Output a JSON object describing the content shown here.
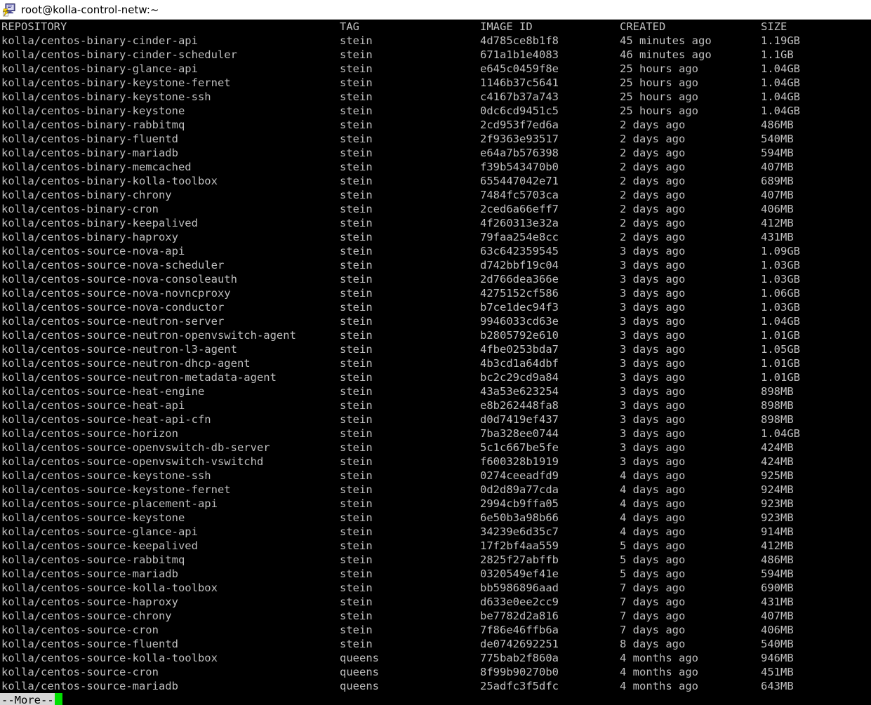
{
  "window": {
    "title": "root@kolla-control-netw:~",
    "icon": "putty-terminal-icon"
  },
  "terminal": {
    "background_color": "#000000",
    "foreground_color": "#bfbfbf",
    "cursor_color": "#00e000",
    "more_prompt": "--More--",
    "more_prompt_bg": "#d6d6d6",
    "more_prompt_fg": "#000000"
  },
  "table": {
    "headers": {
      "repository": "REPOSITORY",
      "tag": "TAG",
      "image_id": "IMAGE ID",
      "created": "CREATED",
      "size": "SIZE"
    },
    "rows": [
      {
        "repository": "kolla/centos-binary-cinder-api",
        "tag": "stein",
        "image_id": "4d785ce8b1f8",
        "created": "45 minutes ago",
        "size": "1.19GB"
      },
      {
        "repository": "kolla/centos-binary-cinder-scheduler",
        "tag": "stein",
        "image_id": "671a1b1e4083",
        "created": "46 minutes ago",
        "size": "1.1GB"
      },
      {
        "repository": "kolla/centos-binary-glance-api",
        "tag": "stein",
        "image_id": "e645c0459f8e",
        "created": "25 hours ago",
        "size": "1.04GB"
      },
      {
        "repository": "kolla/centos-binary-keystone-fernet",
        "tag": "stein",
        "image_id": "1146b37c5641",
        "created": "25 hours ago",
        "size": "1.04GB"
      },
      {
        "repository": "kolla/centos-binary-keystone-ssh",
        "tag": "stein",
        "image_id": "c4167b37a743",
        "created": "25 hours ago",
        "size": "1.04GB"
      },
      {
        "repository": "kolla/centos-binary-keystone",
        "tag": "stein",
        "image_id": "0dc6cd9451c5",
        "created": "25 hours ago",
        "size": "1.04GB"
      },
      {
        "repository": "kolla/centos-binary-rabbitmq",
        "tag": "stein",
        "image_id": "2cd953f7ed6a",
        "created": "2 days ago",
        "size": "486MB"
      },
      {
        "repository": "kolla/centos-binary-fluentd",
        "tag": "stein",
        "image_id": "2f9363e93517",
        "created": "2 days ago",
        "size": "540MB"
      },
      {
        "repository": "kolla/centos-binary-mariadb",
        "tag": "stein",
        "image_id": "e64a7b576398",
        "created": "2 days ago",
        "size": "594MB"
      },
      {
        "repository": "kolla/centos-binary-memcached",
        "tag": "stein",
        "image_id": "f39b543470b0",
        "created": "2 days ago",
        "size": "407MB"
      },
      {
        "repository": "kolla/centos-binary-kolla-toolbox",
        "tag": "stein",
        "image_id": "655447042e71",
        "created": "2 days ago",
        "size": "689MB"
      },
      {
        "repository": "kolla/centos-binary-chrony",
        "tag": "stein",
        "image_id": "7484fc5703ca",
        "created": "2 days ago",
        "size": "407MB"
      },
      {
        "repository": "kolla/centos-binary-cron",
        "tag": "stein",
        "image_id": "2ced6a66eff7",
        "created": "2 days ago",
        "size": "406MB"
      },
      {
        "repository": "kolla/centos-binary-keepalived",
        "tag": "stein",
        "image_id": "4f260313e32a",
        "created": "2 days ago",
        "size": "412MB"
      },
      {
        "repository": "kolla/centos-binary-haproxy",
        "tag": "stein",
        "image_id": "79faa254e8cc",
        "created": "2 days ago",
        "size": "431MB"
      },
      {
        "repository": "kolla/centos-source-nova-api",
        "tag": "stein",
        "image_id": "63c642359545",
        "created": "3 days ago",
        "size": "1.09GB"
      },
      {
        "repository": "kolla/centos-source-nova-scheduler",
        "tag": "stein",
        "image_id": "d742bbf19c04",
        "created": "3 days ago",
        "size": "1.03GB"
      },
      {
        "repository": "kolla/centos-source-nova-consoleauth",
        "tag": "stein",
        "image_id": "2d766dea366e",
        "created": "3 days ago",
        "size": "1.03GB"
      },
      {
        "repository": "kolla/centos-source-nova-novncproxy",
        "tag": "stein",
        "image_id": "4275152cf586",
        "created": "3 days ago",
        "size": "1.06GB"
      },
      {
        "repository": "kolla/centos-source-nova-conductor",
        "tag": "stein",
        "image_id": "b7ce1dec94f3",
        "created": "3 days ago",
        "size": "1.03GB"
      },
      {
        "repository": "kolla/centos-source-neutron-server",
        "tag": "stein",
        "image_id": "9946033cd63e",
        "created": "3 days ago",
        "size": "1.04GB"
      },
      {
        "repository": "kolla/centos-source-neutron-openvswitch-agent",
        "tag": "stein",
        "image_id": "b2805792e610",
        "created": "3 days ago",
        "size": "1.01GB"
      },
      {
        "repository": "kolla/centos-source-neutron-l3-agent",
        "tag": "stein",
        "image_id": "4fbe0253bda7",
        "created": "3 days ago",
        "size": "1.05GB"
      },
      {
        "repository": "kolla/centos-source-neutron-dhcp-agent",
        "tag": "stein",
        "image_id": "4b3cd1a64dbf",
        "created": "3 days ago",
        "size": "1.01GB"
      },
      {
        "repository": "kolla/centos-source-neutron-metadata-agent",
        "tag": "stein",
        "image_id": "bc2c29cd9a84",
        "created": "3 days ago",
        "size": "1.01GB"
      },
      {
        "repository": "kolla/centos-source-heat-engine",
        "tag": "stein",
        "image_id": "43a53e623254",
        "created": "3 days ago",
        "size": "898MB"
      },
      {
        "repository": "kolla/centos-source-heat-api",
        "tag": "stein",
        "image_id": "e8b262448fa8",
        "created": "3 days ago",
        "size": "898MB"
      },
      {
        "repository": "kolla/centos-source-heat-api-cfn",
        "tag": "stein",
        "image_id": "d0d7419ef437",
        "created": "3 days ago",
        "size": "898MB"
      },
      {
        "repository": "kolla/centos-source-horizon",
        "tag": "stein",
        "image_id": "7ba328ee0744",
        "created": "3 days ago",
        "size": "1.04GB"
      },
      {
        "repository": "kolla/centos-source-openvswitch-db-server",
        "tag": "stein",
        "image_id": "5c1c667be5fe",
        "created": "3 days ago",
        "size": "424MB"
      },
      {
        "repository": "kolla/centos-source-openvswitch-vswitchd",
        "tag": "stein",
        "image_id": "f600328b1919",
        "created": "3 days ago",
        "size": "424MB"
      },
      {
        "repository": "kolla/centos-source-keystone-ssh",
        "tag": "stein",
        "image_id": "0274ceeadfd9",
        "created": "4 days ago",
        "size": "925MB"
      },
      {
        "repository": "kolla/centos-source-keystone-fernet",
        "tag": "stein",
        "image_id": "0d2d89a77cda",
        "created": "4 days ago",
        "size": "924MB"
      },
      {
        "repository": "kolla/centos-source-placement-api",
        "tag": "stein",
        "image_id": "2994cb9ffa05",
        "created": "4 days ago",
        "size": "923MB"
      },
      {
        "repository": "kolla/centos-source-keystone",
        "tag": "stein",
        "image_id": "6e50b3a98b66",
        "created": "4 days ago",
        "size": "923MB"
      },
      {
        "repository": "kolla/centos-source-glance-api",
        "tag": "stein",
        "image_id": "34239e6d35c7",
        "created": "4 days ago",
        "size": "914MB"
      },
      {
        "repository": "kolla/centos-source-keepalived",
        "tag": "stein",
        "image_id": "17f2bf4aa559",
        "created": "5 days ago",
        "size": "412MB"
      },
      {
        "repository": "kolla/centos-source-rabbitmq",
        "tag": "stein",
        "image_id": "2825f27abffb",
        "created": "5 days ago",
        "size": "486MB"
      },
      {
        "repository": "kolla/centos-source-mariadb",
        "tag": "stein",
        "image_id": "0320549ef41e",
        "created": "5 days ago",
        "size": "594MB"
      },
      {
        "repository": "kolla/centos-source-kolla-toolbox",
        "tag": "stein",
        "image_id": "bb5986896aad",
        "created": "7 days ago",
        "size": "690MB"
      },
      {
        "repository": "kolla/centos-source-haproxy",
        "tag": "stein",
        "image_id": "d633e0ee2cc9",
        "created": "7 days ago",
        "size": "431MB"
      },
      {
        "repository": "kolla/centos-source-chrony",
        "tag": "stein",
        "image_id": "be7782d2a816",
        "created": "7 days ago",
        "size": "407MB"
      },
      {
        "repository": "kolla/centos-source-cron",
        "tag": "stein",
        "image_id": "7f86e46ffb6a",
        "created": "7 days ago",
        "size": "406MB"
      },
      {
        "repository": "kolla/centos-source-fluentd",
        "tag": "stein",
        "image_id": "de0742692251",
        "created": "8 days ago",
        "size": "540MB"
      },
      {
        "repository": "kolla/centos-source-kolla-toolbox",
        "tag": "queens",
        "image_id": "775bab2f860a",
        "created": "4 months ago",
        "size": "946MB"
      },
      {
        "repository": "kolla/centos-source-cron",
        "tag": "queens",
        "image_id": "8f99b90270b0",
        "created": "4 months ago",
        "size": "451MB"
      },
      {
        "repository": "kolla/centos-source-mariadb",
        "tag": "queens",
        "image_id": "25adfc3f5dfc",
        "created": "4 months ago",
        "size": "643MB"
      }
    ]
  }
}
